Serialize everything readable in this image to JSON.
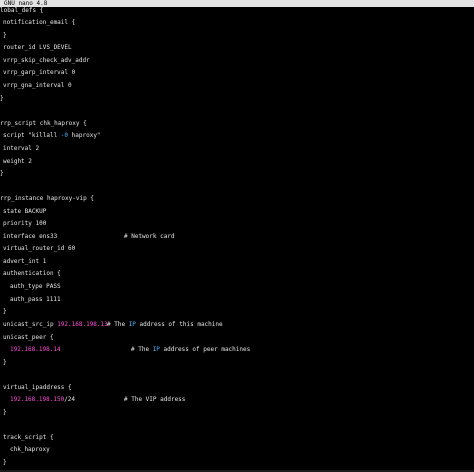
{
  "title_bar": {
    "title": "GNU nano 4.8"
  },
  "colors": {
    "background": "#000000",
    "text": "#e6e6e6",
    "title_bar_bg": "#e3e3e3",
    "ip_highlight": "#ff4fd8",
    "keyword_highlight": "#4fb4ff"
  },
  "editor": {
    "l0": "lobal_defs {",
    "l1": "notification_email {",
    "l2": "}",
    "l3": "router_id LVS_DEVEL",
    "l4": "vrrp_skip_check_adv_addr",
    "l5": "vrrp_garp_interval 0",
    "l6": "vrrp_gna_interval 0",
    "l7": "}",
    "l8": "rrp_script chk_haproxy {",
    "l9_a": "script \"killall ",
    "l9_b": "-0",
    "l9_c": " haproxy\"",
    "l10": "interval 2",
    "l11": "weight 2",
    "l12": "}",
    "l13": "rrp_instance haproxy-vip {",
    "l14": "state BACKUP",
    "l15": "priority 100",
    "l16": "interface ens33",
    "l16_comment": "# Network card",
    "l17": "virtual_router_id 60",
    "l18": "advert_int 1",
    "l19": "authentication {",
    "l20": "auth_type PASS",
    "l21": "auth_pass 1111",
    "l22": "}",
    "l23_a": "unicast_src_ip ",
    "l23_ip": "192.168.198.13",
    "l23_c1": "# The ",
    "l23_c2": "IP",
    "l23_c3": " address of this machine",
    "l24": "unicast_peer {",
    "l25_ip": "192.168.198.14",
    "l25_c1": "# The ",
    "l25_c2": "IP",
    "l25_c3": " address of peer machines",
    "l26": "}",
    "l27": "virtual_ipaddress {",
    "l28_ip": "192.168.198.150",
    "l28_b": "/24",
    "l28_comment": "# The VIP address",
    "l29": "}",
    "l30": "track_script {",
    "l31": "chk_haproxy",
    "l32": "}"
  }
}
